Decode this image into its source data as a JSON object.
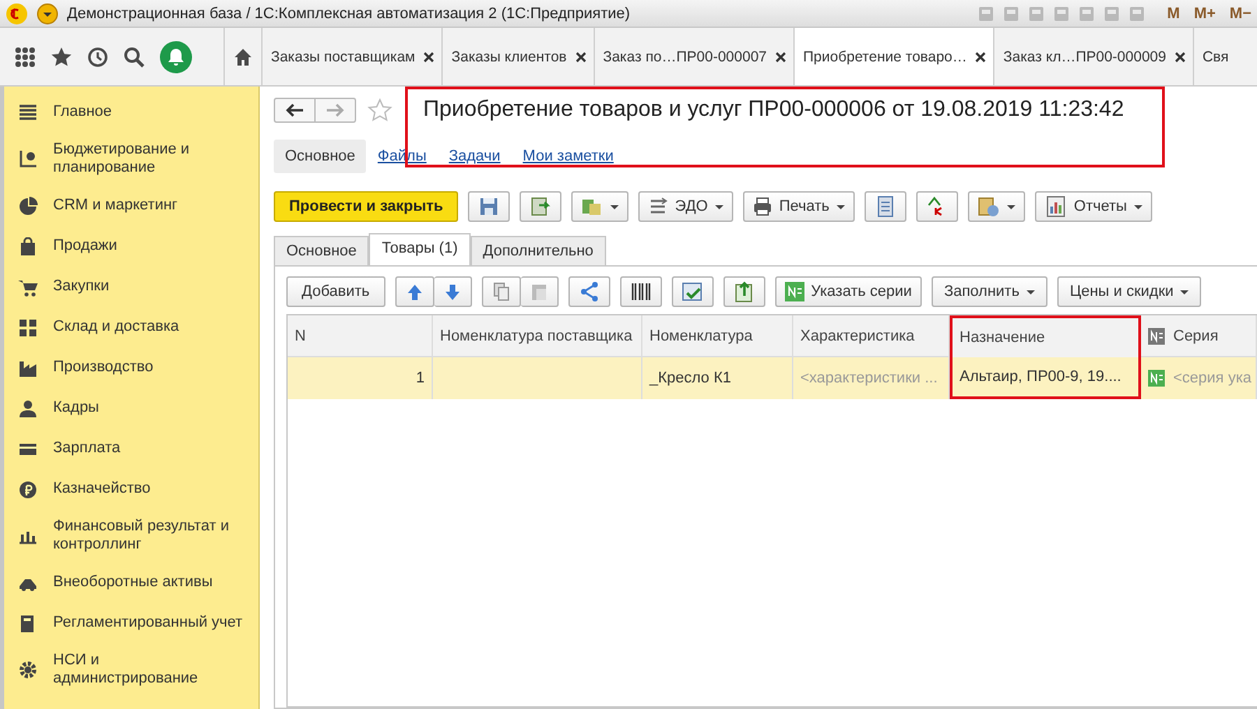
{
  "window": {
    "title": "Демонстрационная база / 1С:Комплексная автоматизация 2  (1С:Предприятие)"
  },
  "titlebar_buttons": [
    "M",
    "M+",
    "M−"
  ],
  "open_tabs": [
    {
      "label": "Заказы поставщикам",
      "selected": false,
      "closable": true
    },
    {
      "label": "Заказы клиентов",
      "selected": false,
      "closable": true
    },
    {
      "label": "Заказ по…ПР00-000007",
      "selected": false,
      "closable": true
    },
    {
      "label": "Приобретение товаро…",
      "selected": true,
      "closable": true
    },
    {
      "label": "Заказ кл…ПР00-000009",
      "selected": false,
      "closable": true
    },
    {
      "label": "Свя",
      "selected": false,
      "closable": false
    }
  ],
  "sidebar": {
    "items": [
      {
        "label": "Главное"
      },
      {
        "label": "Бюджетирование и планирование"
      },
      {
        "label": "CRM и маркетинг"
      },
      {
        "label": "Продажи"
      },
      {
        "label": "Закупки"
      },
      {
        "label": "Склад и доставка"
      },
      {
        "label": "Производство"
      },
      {
        "label": "Кадры"
      },
      {
        "label": "Зарплата"
      },
      {
        "label": "Казначейство"
      },
      {
        "label": "Финансовый результат и контроллинг"
      },
      {
        "label": "Внеоборотные активы"
      },
      {
        "label": "Регламентированный учет"
      },
      {
        "label": "НСИ и администрирование"
      }
    ]
  },
  "document": {
    "title": "Приобретение товаров и услуг ПР00-000006 от 19.08.2019 11:23:42",
    "title_marked": true,
    "links": [
      {
        "label": "Основное",
        "selected": true
      },
      {
        "label": "Файлы",
        "selected": false
      },
      {
        "label": "Задачи",
        "selected": false
      },
      {
        "label": "Мои заметки",
        "selected": false
      }
    ],
    "primary_button": "Провести и закрыть",
    "toolbar": [
      {
        "kind": "icon"
      },
      {
        "kind": "icon"
      },
      {
        "kind": "iconmenu"
      },
      {
        "kind": "menu",
        "label": "ЭДО"
      },
      {
        "kind": "menu",
        "label": "Печать"
      },
      {
        "kind": "icon"
      },
      {
        "kind": "icon"
      },
      {
        "kind": "iconmenu"
      },
      {
        "kind": "menu",
        "label": "Отчеты"
      }
    ],
    "form_tabs": [
      {
        "label": "Основное",
        "selected": false
      },
      {
        "label": "Товары (1)",
        "selected": true
      },
      {
        "label": "Дополнительно",
        "selected": false
      }
    ],
    "table_toolbar": [
      {
        "kind": "text",
        "label": "Добавить"
      },
      {
        "kind": "pair"
      },
      {
        "kind": "pair"
      },
      {
        "kind": "icon"
      },
      {
        "kind": "icon"
      },
      {
        "kind": "icon"
      },
      {
        "kind": "icon"
      },
      {
        "kind": "badge",
        "label": "Указать серии"
      },
      {
        "kind": "menu",
        "label": "Заполнить"
      },
      {
        "kind": "menu",
        "label": "Цены и скидки"
      }
    ],
    "table": {
      "columns": [
        {
          "label": "N",
          "kind": "text",
          "marked": false
        },
        {
          "label": "Номенклатура поставщика",
          "kind": "text",
          "marked": false
        },
        {
          "label": "Номенклатура",
          "kind": "text",
          "marked": false
        },
        {
          "label": "Характеристика",
          "kind": "text",
          "marked": false
        },
        {
          "label": "Назначение",
          "kind": "text",
          "marked": true
        },
        {
          "label": "Серия",
          "kind": "series",
          "marked": false
        }
      ],
      "rows": [
        {
          "selected": true,
          "cells": [
            {
              "value": "1"
            },
            {},
            {
              "value": "_Кресло К1"
            },
            {
              "placeholder": "<характеристики ..."
            },
            {
              "value": "Альтаир, ПР00-9, 19...."
            },
            {
              "placeholder": "<серия ука"
            }
          ]
        }
      ]
    }
  }
}
